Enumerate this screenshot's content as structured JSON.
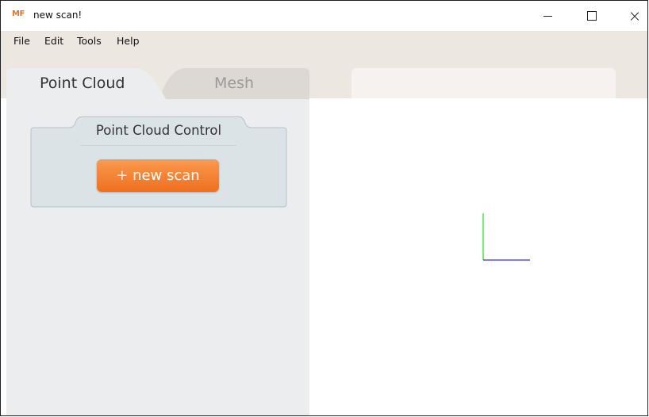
{
  "window": {
    "app_logo": "MF",
    "title": "new scan!",
    "controls": {
      "minimize": "minimize",
      "maximize": "maximize",
      "close": "×"
    }
  },
  "menu": {
    "items": [
      "File",
      "Edit",
      "Tools",
      "Help"
    ]
  },
  "tabs": {
    "point_cloud": "Point Cloud",
    "mesh": "Mesh",
    "active": "Point Cloud"
  },
  "control_panel": {
    "title": "Point Cloud Control",
    "new_scan_label": "+ new scan"
  },
  "viewport": {
    "axes": {
      "y_color": "#28d428",
      "x_color": "#3535c8"
    }
  },
  "colors": {
    "accent": "#f07a2a",
    "menu_bg": "#ede7e2",
    "panel_bg": "#ecedee"
  }
}
